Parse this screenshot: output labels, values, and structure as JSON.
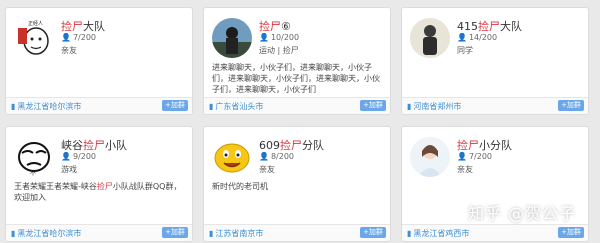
{
  "cards": [
    {
      "title_highlight": "捡尸",
      "title_rest": "大队",
      "members": "7/200",
      "tags": "亲友",
      "desc": "",
      "location": "黑龙江省哈尔滨市",
      "join_label": "+加群",
      "avatar_icon": "cartoon-meme-icon",
      "avatar_text": "正经人"
    },
    {
      "title_highlight": "捡尸",
      "title_rest": "⑥",
      "members": "10/200",
      "tags": "运动  |  捡尸",
      "desc": "进来聊聊天，小伙子们，进来聊聊天，小伙子们，进来聊聊天，小伙子们，进来聊聊天，小伙子们，进来聊聊天，小伙子们",
      "location": "广东省汕头市",
      "join_label": "+加群",
      "avatar_icon": "photo-person-icon"
    },
    {
      "title_prefix": "415",
      "title_highlight": "捡尸",
      "title_rest": "大队",
      "members": "14/200",
      "tags": "同学",
      "desc": "",
      "location": "河南省郑州市",
      "join_label": "+加群",
      "avatar_icon": "photo-person-icon"
    },
    {
      "title_prefix": "峡谷",
      "title_highlight": "捡尸",
      "title_rest": "小队",
      "members": "9/200",
      "tags": "游戏",
      "desc_prefix": "王者荣耀王者荣耀-峡谷",
      "desc_highlight": "捡尸",
      "desc_rest": "小队战队群QQ群，欢迎加入",
      "location": "黑龙江省哈尔滨市",
      "join_label": "+加群",
      "avatar_icon": "cartoon-meme-icon",
      "avatar_text": "不"
    },
    {
      "title_prefix": "609",
      "title_highlight": "捡尸",
      "title_rest": "分队",
      "members": "8/200",
      "tags": "亲友",
      "desc": "新时代的老司机",
      "location": "江苏省南京市",
      "join_label": "+加群",
      "avatar_icon": "emoji-face-icon"
    },
    {
      "title_highlight": "捡尸",
      "title_rest": "小分队",
      "members": "7/200",
      "tags": "亲友",
      "desc": "",
      "location": "黑龙江省鸡西市",
      "join_label": "+加群",
      "avatar_icon": "default-avatar-icon"
    }
  ],
  "watermark": "知乎 @贺公子",
  "colors": {
    "highlight": "#d9363e",
    "location": "#3c8fd6",
    "join_button": "#6aa6e8"
  }
}
